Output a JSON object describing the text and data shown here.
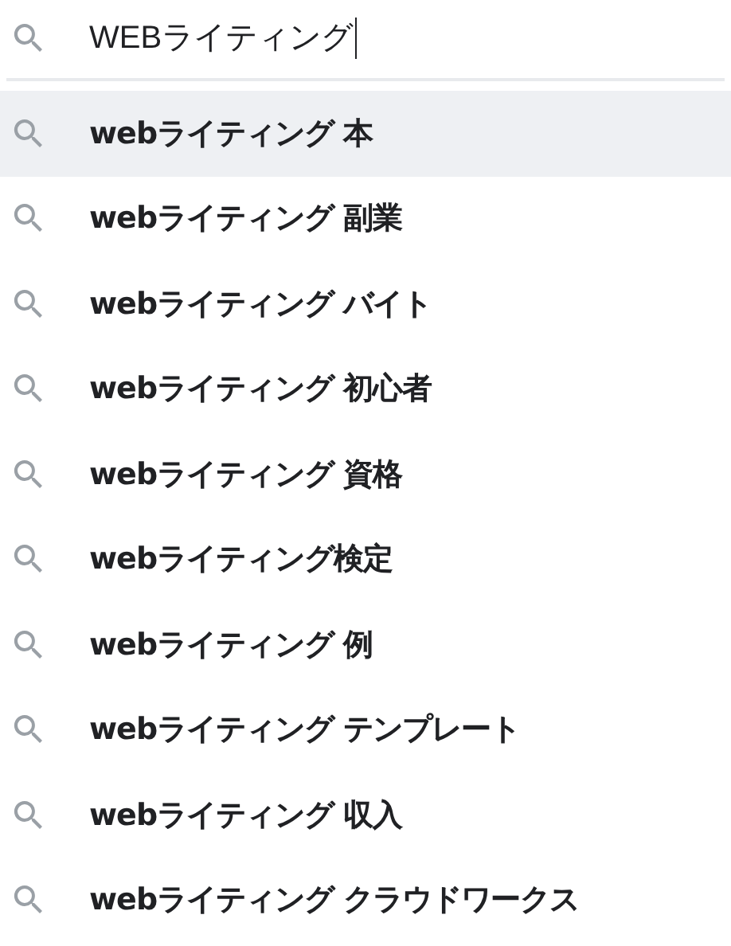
{
  "search": {
    "value": "WEBライティング"
  },
  "suggestions": [
    {
      "text": "webライティング 本",
      "selected": true
    },
    {
      "text": "webライティング 副業",
      "selected": false
    },
    {
      "text": "webライティング バイト",
      "selected": false
    },
    {
      "text": "webライティング 初心者",
      "selected": false
    },
    {
      "text": "webライティング 資格",
      "selected": false
    },
    {
      "text": "webライティング検定",
      "selected": false
    },
    {
      "text": "webライティング 例",
      "selected": false
    },
    {
      "text": "webライティング テンプレート",
      "selected": false
    },
    {
      "text": "webライティング 収入",
      "selected": false
    },
    {
      "text": "webライティング クラウドワークス",
      "selected": false
    }
  ]
}
